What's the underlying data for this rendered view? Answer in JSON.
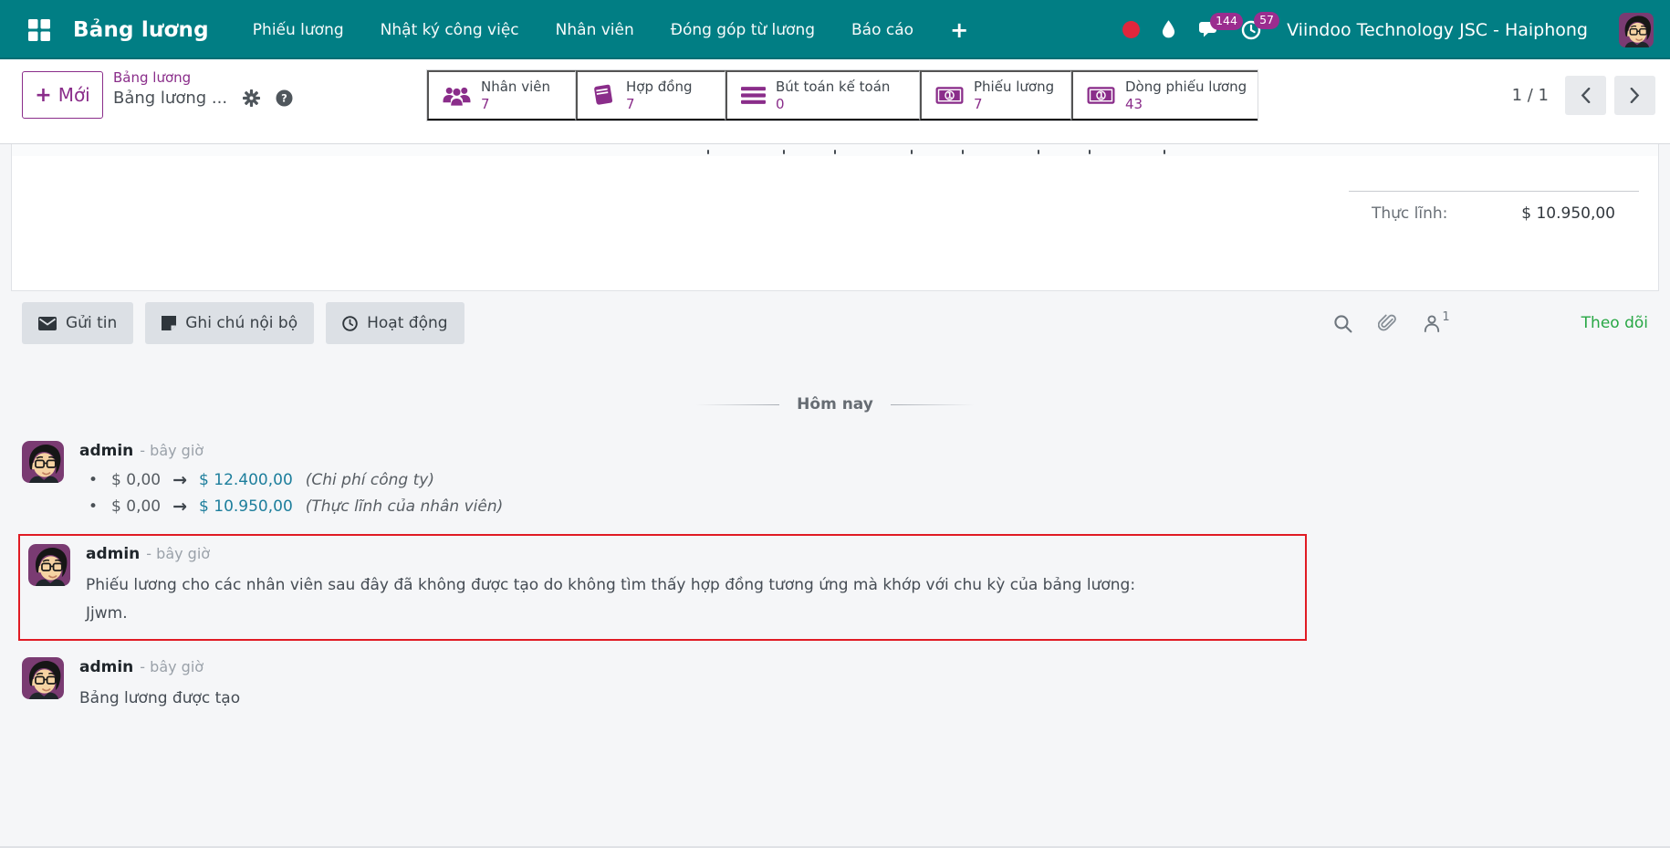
{
  "topbar": {
    "app_title": "Bảng lương",
    "menu": [
      "Phiếu lương",
      "Nhật ký công việc",
      "Nhân viên",
      "Đóng góp từ lương",
      "Báo cáo"
    ],
    "messages_badge": "144",
    "activities_badge": "57",
    "company": "Viindoo Technology JSC - Haiphong"
  },
  "control_panel": {
    "new_label": "Mới",
    "breadcrumb": {
      "parent": "Bảng lương",
      "current": "Bảng lương ..."
    },
    "stat_buttons": [
      {
        "label": "Nhân viên",
        "count": "7",
        "icon": "users-icon"
      },
      {
        "label": "Hợp đồng",
        "count": "7",
        "icon": "book-icon"
      },
      {
        "label": "Bút toán kế toán",
        "count": "0",
        "icon": "bars-icon"
      },
      {
        "label": "Phiếu lương",
        "count": "7",
        "icon": "banknote-icon"
      },
      {
        "label": "Dòng phiếu lương",
        "count": "43",
        "icon": "banknote-icon"
      }
    ],
    "pager": {
      "text": "1 / 1"
    }
  },
  "sheet": {
    "net_label": "Thực lĩnh:",
    "net_value": "$ 10.950,00"
  },
  "chatter": {
    "buttons": {
      "send": "Gửi tin",
      "log": "Ghi chú nội bộ",
      "activity": "Hoạt động"
    },
    "followers_count": "1",
    "follow_label": "Theo dõi",
    "date_divider": "Hôm nay",
    "messages": [
      {
        "author": "admin",
        "time": "- bây giờ",
        "tracking": [
          {
            "old": "$ 0,00",
            "new": "$ 12.400,00",
            "note": "(Chi phí công ty)"
          },
          {
            "old": "$ 0,00",
            "new": "$ 10.950,00",
            "note": "(Thực lĩnh của nhân viên)"
          }
        ]
      },
      {
        "author": "admin",
        "time": "- bây giờ",
        "highlighted": true,
        "body_lines": [
          "Phiếu lương cho các nhân viên sau đây đã không được tạo do không tìm thấy hợp đồng tương ứng mà khớp với chu kỳ của bảng lương:",
          "Jjwm."
        ]
      },
      {
        "author": "admin",
        "time": "- bây giờ",
        "body_lines": [
          "Bảng lương được tạo"
        ]
      }
    ]
  },
  "colors": {
    "topbar_teal": "#017e84",
    "accent_purple": "#8a2d8a",
    "badge_purple": "#9b2d8f",
    "tracking_teal": "#1d7e9c",
    "follow_green": "#28a745",
    "alert_red": "#e01b24"
  }
}
